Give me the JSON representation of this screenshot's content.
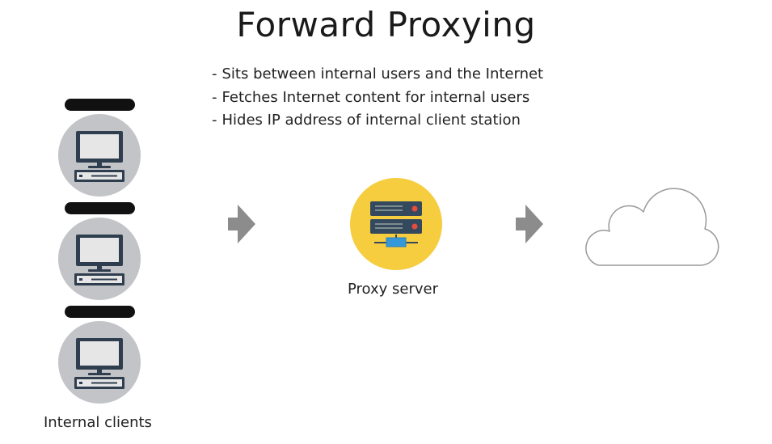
{
  "title": "Forward Proxying",
  "bullets": [
    "Sits between internal users and the Internet",
    "Fetches Internet content for internal users",
    "Hides IP address of internal client station"
  ],
  "bullet_marker": "-",
  "labels": {
    "proxy_server": "Proxy server",
    "internal_clients": "Internal clients"
  },
  "colors": {
    "client_circle": "#c3c4c7",
    "proxy_circle": "#f6cd3e",
    "server_body": "#34495e",
    "server_led": "#e74c3c",
    "network_connector": "#3498db",
    "arrow": "#8c8c8c",
    "cloud_stroke": "#9a9a9a",
    "bar": "#111111"
  },
  "icons": {
    "clients": [
      "desktop-computer-icon",
      "desktop-computer-icon",
      "desktop-computer-icon"
    ],
    "proxy": "server-rack-icon",
    "internet": "cloud-icon",
    "flow": "arrow-right-icon"
  }
}
